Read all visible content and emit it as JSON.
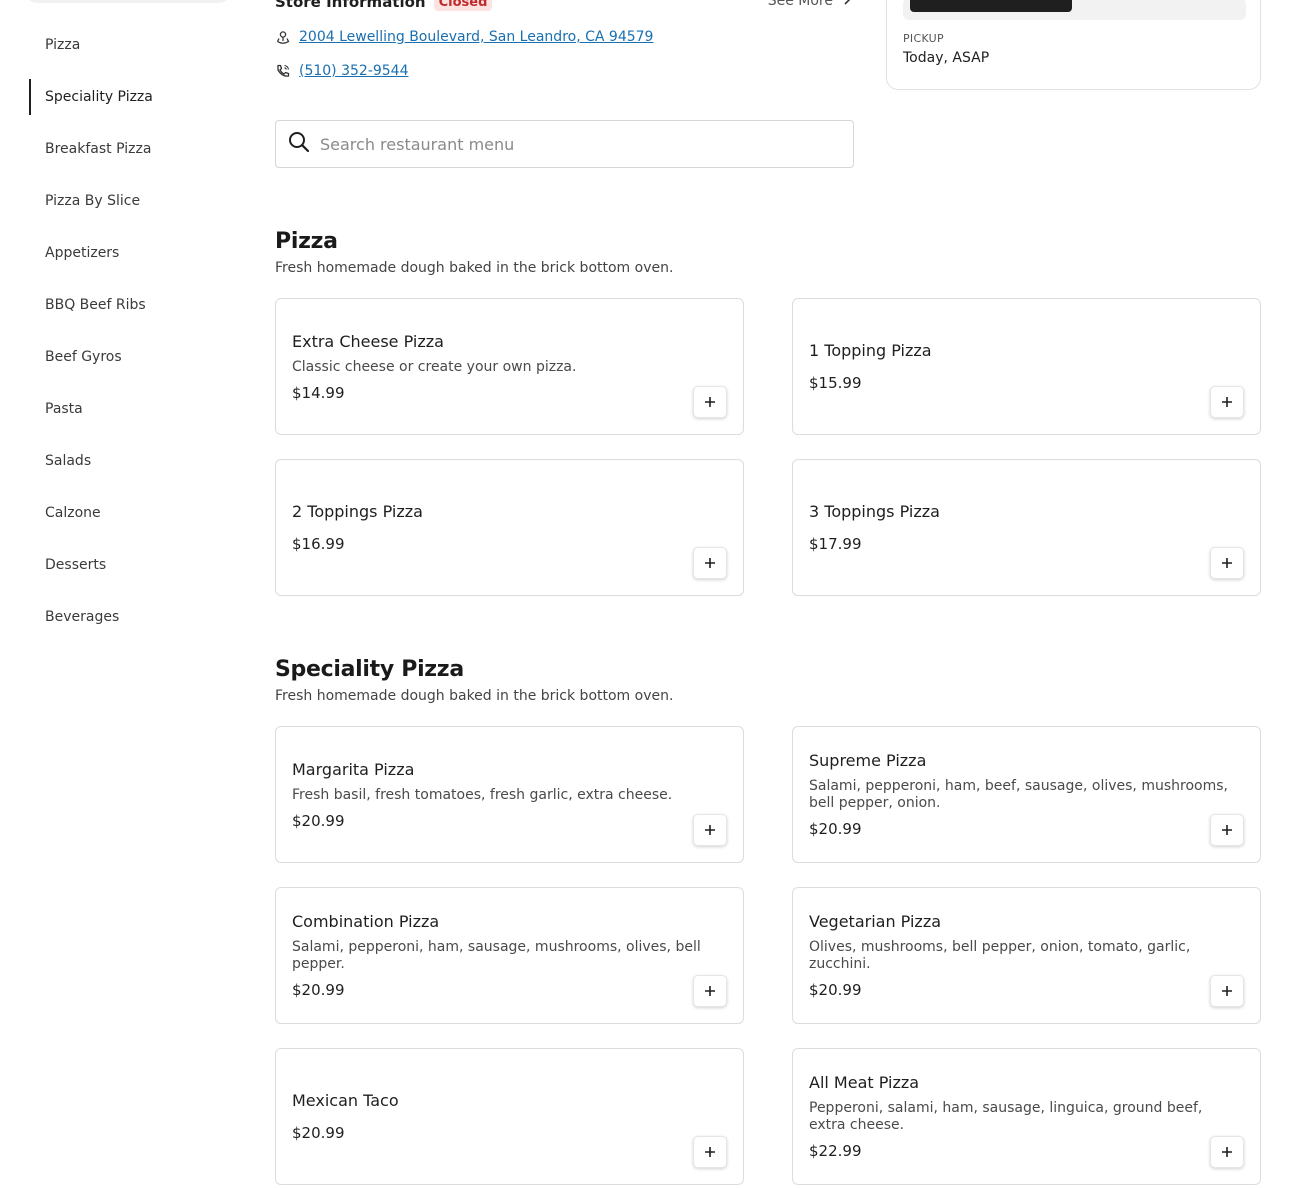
{
  "sidebar": {
    "items": [
      {
        "label": "Pizza",
        "active": false
      },
      {
        "label": "Speciality Pizza",
        "active": true
      },
      {
        "label": "Breakfast Pizza",
        "active": false
      },
      {
        "label": "Pizza By Slice",
        "active": false
      },
      {
        "label": "Appetizers",
        "active": false
      },
      {
        "label": "BBQ Beef Ribs",
        "active": false
      },
      {
        "label": "Beef Gyros",
        "active": false
      },
      {
        "label": "Pasta",
        "active": false
      },
      {
        "label": "Salads",
        "active": false
      },
      {
        "label": "Calzone",
        "active": false
      },
      {
        "label": "Desserts",
        "active": false
      },
      {
        "label": "Beverages",
        "active": false
      }
    ]
  },
  "store": {
    "title": "Store Information",
    "status": "Closed",
    "see_more": "See More",
    "address": "2004 Lewelling Boulevard, San Leandro, CA 94579",
    "phone": "(510) 352-9544"
  },
  "search": {
    "placeholder": "Search restaurant menu",
    "value": ""
  },
  "pickup": {
    "label": "PICKUP",
    "value": "Today, ASAP"
  },
  "sections": [
    {
      "title": "Pizza",
      "description": "Fresh homemade dough baked in the brick bottom oven.",
      "items": [
        {
          "name": "Extra Cheese Pizza",
          "description": "Classic cheese or create your own pizza.",
          "price": "$14.99"
        },
        {
          "name": "1 Topping Pizza",
          "description": "",
          "price": "$15.99"
        },
        {
          "name": "2 Toppings Pizza",
          "description": "",
          "price": "$16.99"
        },
        {
          "name": "3 Toppings Pizza",
          "description": "",
          "price": "$17.99"
        }
      ]
    },
    {
      "title": "Speciality Pizza",
      "description": "Fresh homemade dough baked in the brick bottom oven.",
      "items": [
        {
          "name": "Margarita Pizza",
          "description": "Fresh basil, fresh tomatoes, fresh garlic, extra cheese.",
          "price": "$20.99"
        },
        {
          "name": "Supreme Pizza",
          "description": "Salami, pepperoni, ham, beef, sausage, olives, mushrooms, bell pepper, onion.",
          "price": "$20.99"
        },
        {
          "name": "Combination Pizza",
          "description": "Salami, pepperoni, ham, sausage, mushrooms, olives, bell pepper.",
          "price": "$20.99"
        },
        {
          "name": "Vegetarian Pizza",
          "description": "Olives, mushrooms, bell pepper, onion, tomato, garlic, zucchini.",
          "price": "$20.99"
        },
        {
          "name": "Mexican Taco",
          "description": "",
          "price": "$20.99"
        },
        {
          "name": "All Meat Pizza",
          "description": "Pepperoni, salami, ham, sausage, linguica, ground beef, extra cheese.",
          "price": "$22.99"
        }
      ]
    }
  ],
  "icons": {
    "search": "search-icon",
    "location": "location-pin-icon",
    "phone": "phone-icon",
    "chevron": "chevron-right-icon",
    "add": "plus-icon"
  },
  "colors": {
    "link": "#1a6fb0",
    "closed_badge_bg": "#fde2e2",
    "closed_badge_text": "#c02a2a",
    "active_indicator": "#1f1f1f"
  }
}
